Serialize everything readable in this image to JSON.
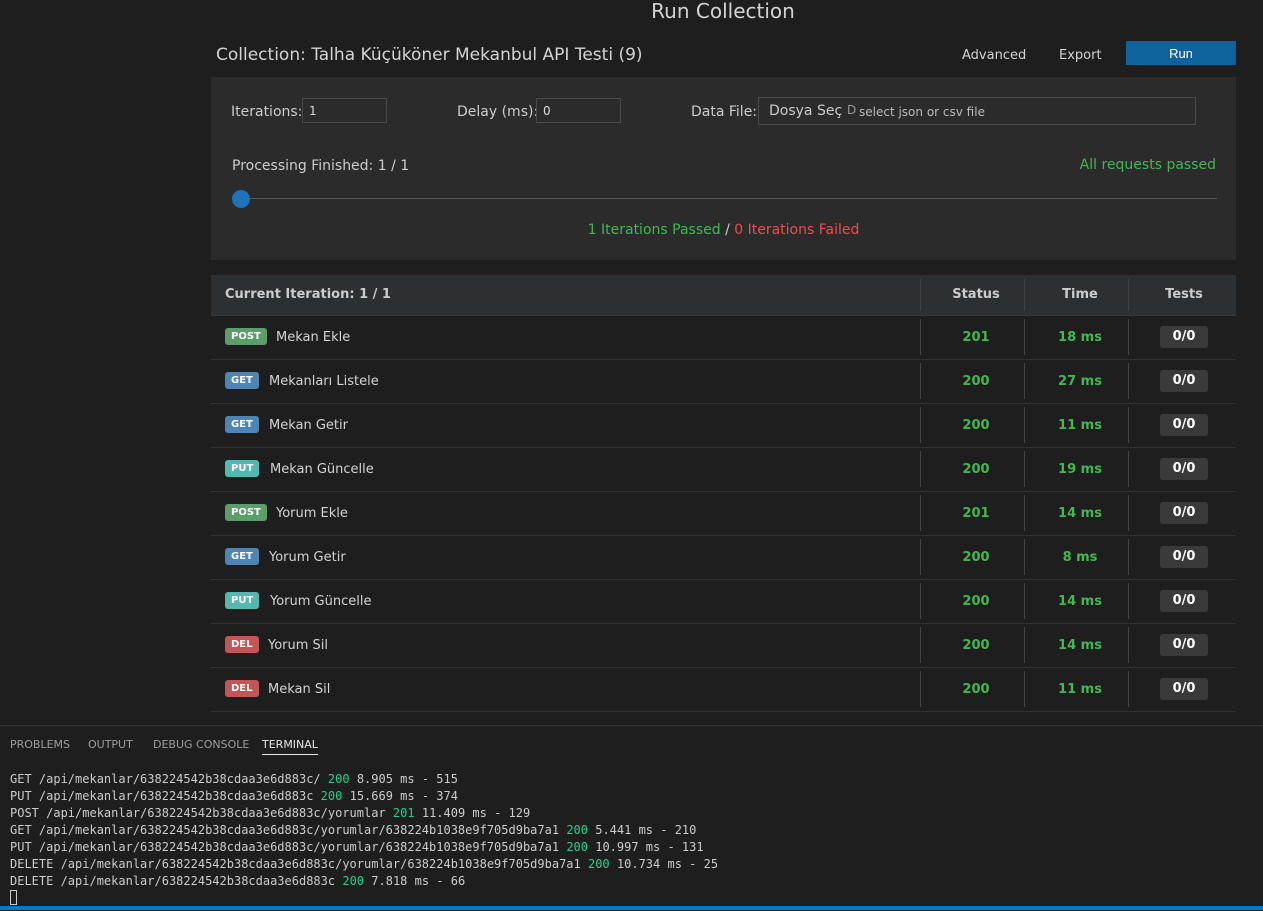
{
  "title": "Run Collection",
  "collection": "Collection: Talha Küçüköner Mekanbul API Testi (9)",
  "toolbar": {
    "advanced": "Advanced",
    "export": "Export",
    "run": "Run"
  },
  "settings": {
    "iterations_label": "Iterations:",
    "iterations_value": "1",
    "delay_label": "Delay (ms):",
    "delay_value": "0",
    "datafile_label": "Data File:",
    "choose_label": "Dosya Seç",
    "choose_chip": "D",
    "datafile_placeholder": "select json or csv file"
  },
  "progress": {
    "label": "Processing Finished: 1 / 1",
    "status": "All requests passed",
    "fraction": 0,
    "passed": "1 Iterations Passed",
    "separator": "/",
    "failed": "0 Iterations Failed"
  },
  "table": {
    "headers": {
      "iteration": "Current Iteration: 1 / 1",
      "status": "Status",
      "time": "Time",
      "tests": "Tests"
    },
    "rows": [
      {
        "method": "POST",
        "name": "Mekan Ekle",
        "status": "201",
        "time": "18 ms",
        "tests": "0/0"
      },
      {
        "method": "GET",
        "name": "Mekanları Listele",
        "status": "200",
        "time": "27 ms",
        "tests": "0/0"
      },
      {
        "method": "GET",
        "name": "Mekan Getir",
        "status": "200",
        "time": "11 ms",
        "tests": "0/0"
      },
      {
        "method": "PUT",
        "name": "Mekan Güncelle",
        "status": "200",
        "time": "19 ms",
        "tests": "0/0"
      },
      {
        "method": "POST",
        "name": "Yorum Ekle",
        "status": "201",
        "time": "14 ms",
        "tests": "0/0"
      },
      {
        "method": "GET",
        "name": "Yorum Getir",
        "status": "200",
        "time": "8 ms",
        "tests": "0/0"
      },
      {
        "method": "PUT",
        "name": "Yorum Güncelle",
        "status": "200",
        "time": "14 ms",
        "tests": "0/0"
      },
      {
        "method": "DEL",
        "name": "Yorum Sil",
        "status": "200",
        "time": "14 ms",
        "tests": "0/0"
      },
      {
        "method": "DEL",
        "name": "Mekan Sil",
        "status": "200",
        "time": "11 ms",
        "tests": "0/0"
      }
    ]
  },
  "panel_tabs": [
    "PROBLEMS",
    "OUTPUT",
    "DEBUG CONSOLE",
    "TERMINAL"
  ],
  "terminal": [
    {
      "pre": "GET /api/mekanlar/638224542b38cdaa3e6d883c/",
      "code": "200",
      "post": "8.905 ms - 515"
    },
    {
      "pre": "PUT /api/mekanlar/638224542b38cdaa3e6d883c",
      "code": "200",
      "post": "15.669 ms - 374"
    },
    {
      "pre": "POST /api/mekanlar/638224542b38cdaa3e6d883c/yorumlar",
      "code": "201",
      "post": "11.409 ms - 129"
    },
    {
      "pre": "GET /api/mekanlar/638224542b38cdaa3e6d883c/yorumlar/638224b1038e9f705d9ba7a1",
      "code": "200",
      "post": "5.441 ms - 210"
    },
    {
      "pre": "PUT /api/mekanlar/638224542b38cdaa3e6d883c/yorumlar/638224b1038e9f705d9ba7a1",
      "code": "200",
      "post": "10.997 ms - 131"
    },
    {
      "pre": "DELETE /api/mekanlar/638224542b38cdaa3e6d883c/yorumlar/638224b1038e9f705d9ba7a1",
      "code": "200",
      "post": "10.734 ms - 25"
    },
    {
      "pre": "DELETE /api/mekanlar/638224542b38cdaa3e6d883c",
      "code": "200",
      "post": "7.818 ms - 66"
    }
  ]
}
